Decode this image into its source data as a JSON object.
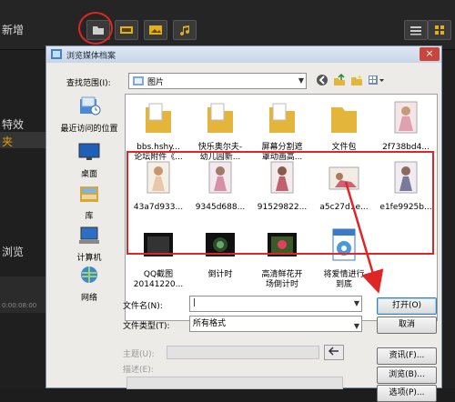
{
  "app": {
    "title": "新增",
    "side_labels": [
      "特效",
      "夹",
      "浏览"
    ],
    "timecode": "0:00:08:00"
  },
  "dialog": {
    "title": "浏览媒体档案",
    "close": "×",
    "look_in_label": "查找范围(I):",
    "look_in_value": "图片",
    "places": [
      {
        "label": "最近访问的位置"
      },
      {
        "label": "桌面"
      },
      {
        "label": "库"
      },
      {
        "label": "计算机"
      },
      {
        "label": "网络"
      }
    ],
    "files_row1": [
      {
        "name": "bbs.hshy...",
        "name2": "论坛附件《...",
        "kind": "folder"
      },
      {
        "name": "快乐奥尔夫-",
        "name2": "幼儿园新...",
        "kind": "folder"
      },
      {
        "name": "屏幕分割遮",
        "name2": "罩动画高...",
        "kind": "folder"
      },
      {
        "name": "文件包",
        "name2": "",
        "kind": "folder"
      },
      {
        "name": "2f738bd4...",
        "name2": "",
        "kind": "photo"
      }
    ],
    "files_row2": [
      {
        "name": "43a7d933...",
        "kind": "photo"
      },
      {
        "name": "9345d688...",
        "kind": "photo"
      },
      {
        "name": "91529822...",
        "kind": "photo"
      },
      {
        "name": "a5c27d1e...",
        "kind": "photo"
      },
      {
        "name": "e1fe9925b...",
        "kind": "photo"
      }
    ],
    "files_row3": [
      {
        "name": "QQ截图",
        "name2": "20141220...",
        "kind": "video"
      },
      {
        "name": "倒计时",
        "name2": "",
        "kind": "video"
      },
      {
        "name": "高清鲜花开",
        "name2": "场倒计时",
        "kind": "video"
      },
      {
        "name": "将爱情进行",
        "name2": "到底",
        "kind": "mp3"
      }
    ],
    "filename_label": "文件名(N):",
    "filename_value": "|",
    "filetype_label": "文件类型(T):",
    "filetype_value": "所有格式",
    "open_button": "打开(O)",
    "cancel_button": "取消",
    "subject_label": "主题(U):",
    "desc_label": "描述(E):",
    "info_button": "资讯(F)...",
    "browse_button": "浏览(B)...",
    "options_button": "选项(P)..."
  },
  "colors": {
    "highlight_red": "#e02525",
    "dialog_bg": "#ecebe7",
    "app_bg": "#1d1d1d"
  }
}
